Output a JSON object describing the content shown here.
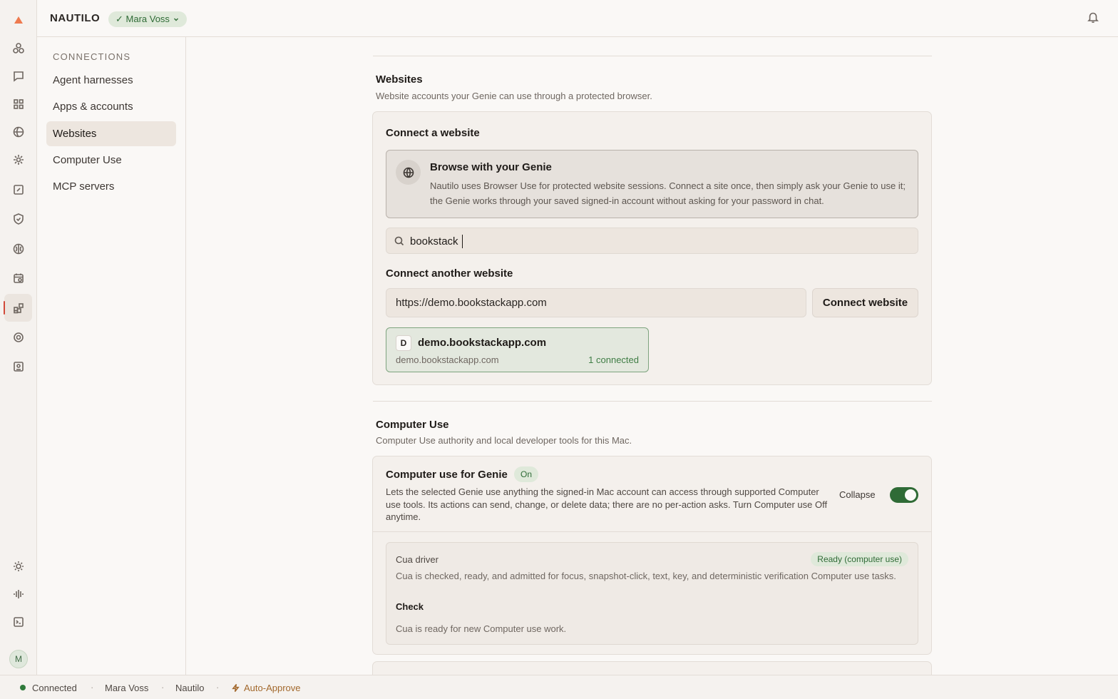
{
  "app": {
    "brand": "NAUTILO",
    "user_pill": "✓ Mara Voss",
    "avatar_initial": "M"
  },
  "rail": {
    "icons": [
      "logo-icon",
      "agents-icon",
      "chat-icon",
      "apps-grid-icon",
      "browser-icon",
      "sparkle-icon",
      "editor-icon",
      "shield-icon",
      "brain-icon",
      "schedule-icon",
      "connections-icon",
      "settings-icon",
      "computer-icon",
      "theme-icon",
      "voice-icon",
      "terminal-icon"
    ],
    "active": "connections-icon"
  },
  "subnav": {
    "heading": "CONNECTIONS",
    "items": [
      {
        "label": "Agent harnesses"
      },
      {
        "label": "Apps & accounts"
      },
      {
        "label": "Websites"
      },
      {
        "label": "Computer Use"
      },
      {
        "label": "MCP servers"
      }
    ],
    "active_index": 2
  },
  "websites": {
    "title": "Websites",
    "subtitle": "Website accounts your Genie can use through a protected browser.",
    "card_title": "Connect a website",
    "genie_title": "Browse with your Genie",
    "genie_desc": "Nautilo uses Browser Use for protected website sessions. Connect a site once, then simply ask your Genie to use it; the Genie works through your saved signed-in account without asking for your password in chat.",
    "search_value": "bookstack",
    "connect_another_label": "Connect another website",
    "url_value": "https://demo.bookstackapp.com",
    "connect_button": "Connect website",
    "site": {
      "badge": "D",
      "name": "demo.bookstackapp.com",
      "domain": "demo.bookstackapp.com",
      "count": "1 connected"
    }
  },
  "computer_use": {
    "title": "Computer Use",
    "subtitle": "Computer Use authority and local developer tools for this Mac.",
    "card_title": "Computer use for Genie",
    "state_pill": "On",
    "desc": "Lets the selected Genie use anything the signed-in Mac account can access through supported Computer use tools. Its actions can send, change, or delete data; there are no per-action asks. Turn Computer use Off anytime.",
    "collapse_label": "Collapse",
    "toggle_on": true,
    "driver": {
      "label": "Cua driver",
      "status_pill": "Ready (computer use)",
      "desc": "Cua is checked, ready, and admitted for focus, snapshot-click, text, key, and deterministic verification Computer use tasks.",
      "check_label": "Check",
      "status_text": "Cua is ready for new Computer use work."
    }
  },
  "statusbar": {
    "connection": "Connected",
    "user": "Mara Voss",
    "app": "Nautilo",
    "auto_approve": "Auto-Approve",
    "sep": "·"
  },
  "colors": {
    "accent_green": "#2f6b36",
    "active_marker": "#d24a3a",
    "auto_approve": "#a2682c"
  }
}
